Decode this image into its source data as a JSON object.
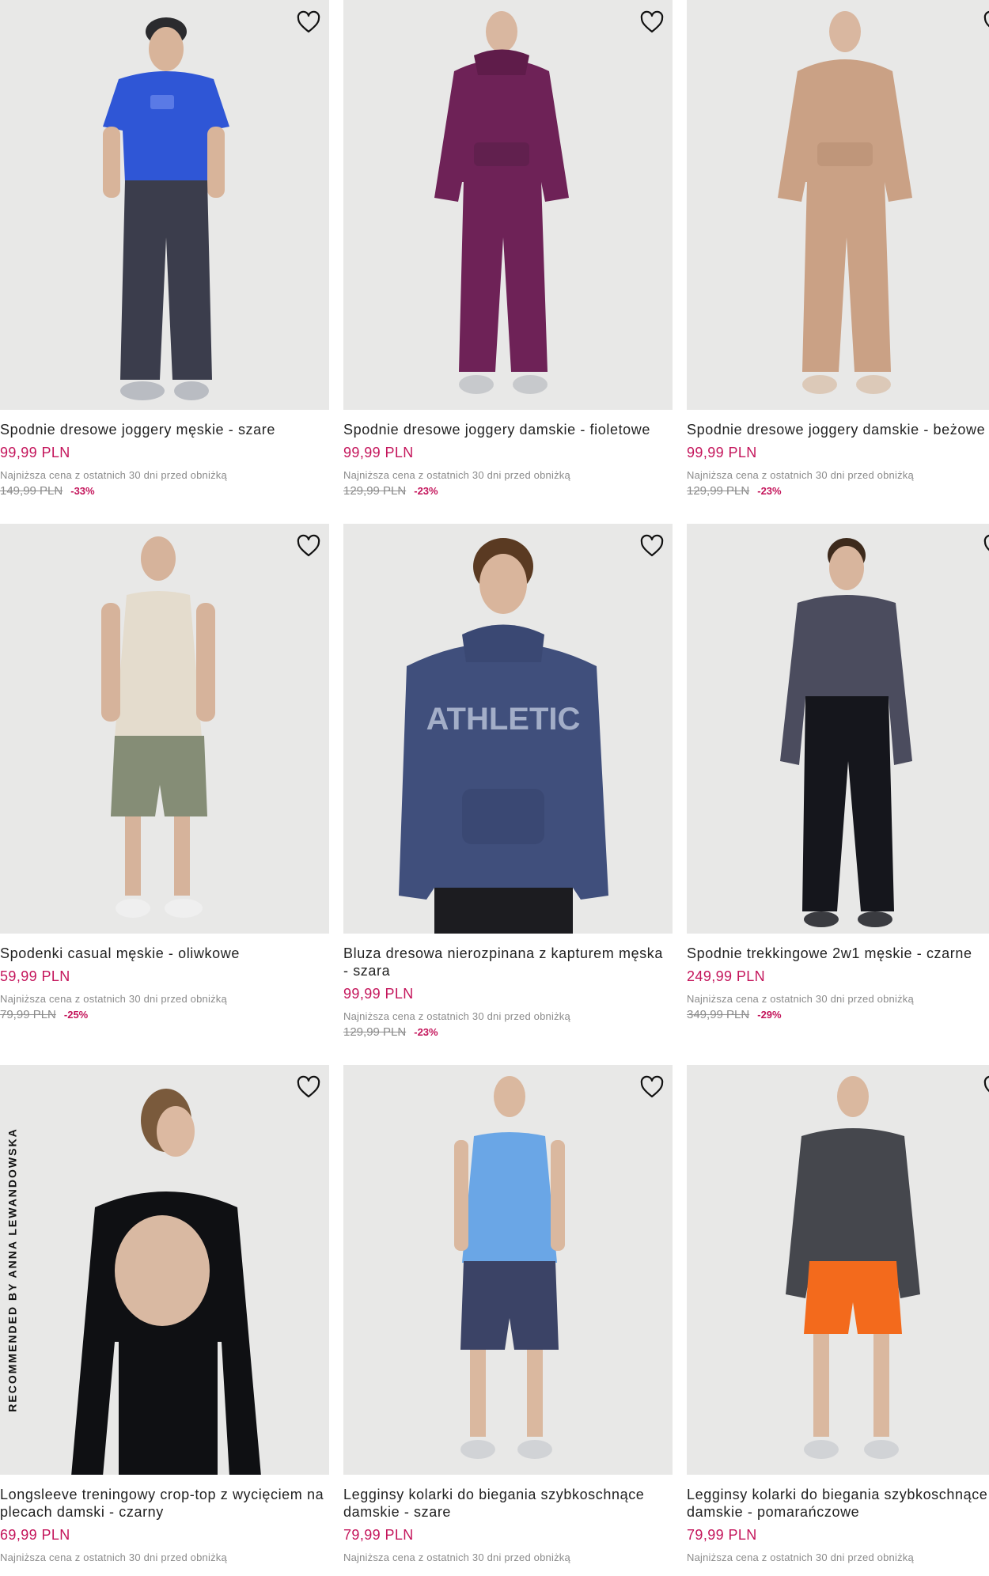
{
  "products": [
    {
      "name": "Spodnie dresowe joggery męskie - szare",
      "price": "99,99 PLN",
      "lowest_label": "Najniższa cena z ostatnich 30 dni przed obniżką",
      "old_price": "149,99 PLN",
      "discount": "-33%"
    },
    {
      "name": "Spodnie dresowe joggery damskie - fioletowe",
      "price": "99,99 PLN",
      "lowest_label": "Najniższa cena z ostatnich 30 dni przed obniżką",
      "old_price": "129,99 PLN",
      "discount": "-23%"
    },
    {
      "name": "Spodnie dresowe joggery damskie - beżowe",
      "price": "99,99 PLN",
      "lowest_label": "Najniższa cena z ostatnich 30 dni przed obniżką",
      "old_price": "129,99 PLN",
      "discount": "-23%"
    },
    {
      "name": "Spodenki casual męskie - oliwkowe",
      "price": "59,99 PLN",
      "lowest_label": "Najniższa cena z ostatnich 30 dni przed obniżką",
      "old_price": "79,99 PLN",
      "discount": "-25%"
    },
    {
      "name": "Bluza dresowa nierozpinana z kapturem męska - szara",
      "price": "99,99 PLN",
      "lowest_label": "Najniższa cena z ostatnich 30 dni przed obniżką",
      "old_price": "129,99 PLN",
      "discount": "-23%",
      "print_text": "ATHLETIC"
    },
    {
      "name": "Spodnie trekkingowe 2w1 męskie - czarne",
      "price": "249,99 PLN",
      "lowest_label": "Najniższa cena z ostatnich 30 dni przed obniżką",
      "old_price": "349,99 PLN",
      "discount": "-29%"
    },
    {
      "name": "Longsleeve treningowy crop-top z wycięciem na plecach damski - czarny",
      "price": "69,99 PLN",
      "lowest_label": "Najniższa cena z ostatnich 30 dni przed obniżką",
      "ribbon": "RECOMMENDED BY ANNA LEWANDOWSKA"
    },
    {
      "name": "Legginsy kolarki do biegania szybkoschnące damskie - szare",
      "price": "79,99 PLN",
      "lowest_label": "Najniższa cena z ostatnich 30 dni przed obniżką"
    },
    {
      "name": "Legginsy kolarki do biegania szybkoschnące damskie - pomarańczowe",
      "price": "79,99 PLN",
      "lowest_label": "Najniższa cena z ostatnich 30 dni przed obniżką"
    }
  ],
  "icons": {
    "favorite": "heart-outline-icon"
  },
  "colors": {
    "price": "#c4155b",
    "muted": "#8b8b8b",
    "image_bg": "#e9e9e9"
  }
}
